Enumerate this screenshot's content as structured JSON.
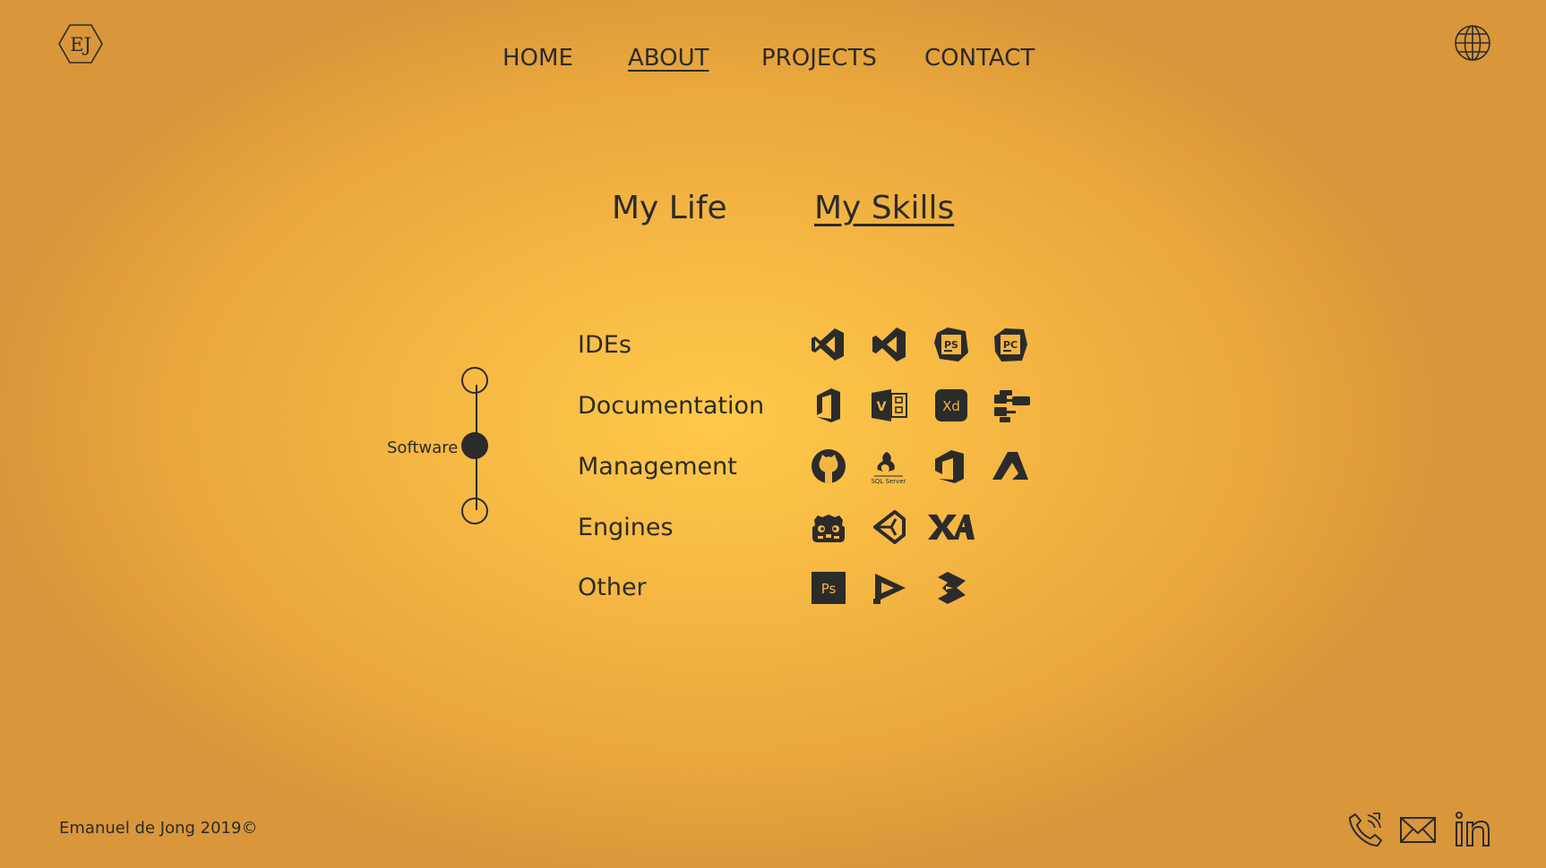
{
  "logo": {
    "text": "EJ"
  },
  "nav": {
    "home": "HOME",
    "about": "ABOUT",
    "projects": "PROJECTS",
    "contact": "CONTACT"
  },
  "tabs": {
    "life": "My Life",
    "skills": "My Skills"
  },
  "stepper": {
    "current": "Software"
  },
  "categories": [
    {
      "label": "IDEs",
      "icons": [
        "visual-studio-icon",
        "vscode-icon",
        "phpstorm-icon",
        "pycharm-icon"
      ]
    },
    {
      "label": "Documentation",
      "icons": [
        "office-icon",
        "visio-icon",
        "adobe-xd-icon",
        "diagram-icon"
      ]
    },
    {
      "label": "Management",
      "icons": [
        "github-icon",
        "sql-server-icon",
        "azure-devops-icon",
        "azure-icon"
      ]
    },
    {
      "label": "Engines",
      "icons": [
        "godot-icon",
        "unity-icon",
        "xna-icon"
      ]
    },
    {
      "label": "Other",
      "icons": [
        "photoshop-icon",
        "media-player-icon",
        "ps-box-icon"
      ]
    }
  ],
  "icon_text": {
    "phpstorm": "PS",
    "pycharm": "PC",
    "visio": "V",
    "xd": "Xd",
    "photoshop": "Ps",
    "sql_server": "SQL Server"
  },
  "footer": {
    "copyright": "Emanuel de Jong 2019©"
  },
  "contact_icons": [
    "phone-icon",
    "mail-icon",
    "linkedin-icon"
  ],
  "colors": {
    "accent": "#2b2b2b",
    "background": "#f5b743"
  }
}
